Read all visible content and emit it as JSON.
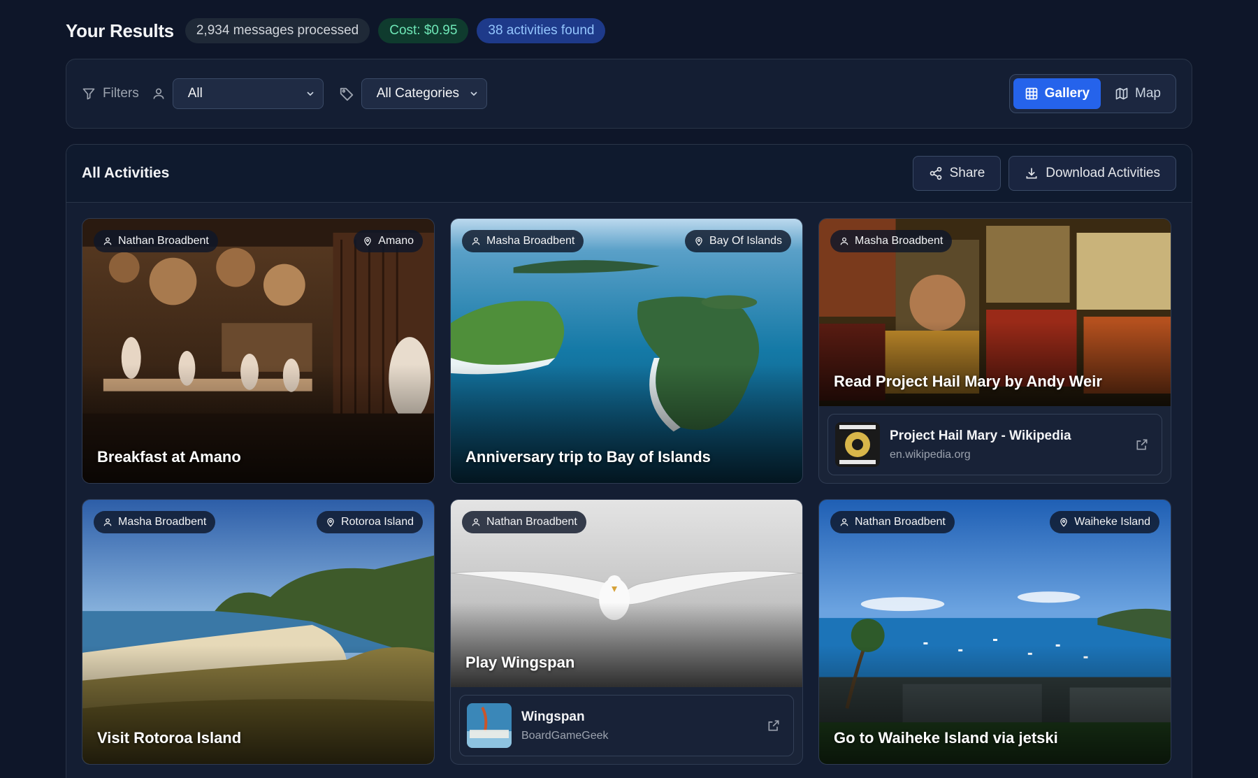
{
  "header": {
    "title": "Your Results",
    "messages_processed": "2,934 messages processed",
    "cost": "Cost: $0.95",
    "activities_found": "38 activities found"
  },
  "filters": {
    "label": "Filters",
    "person_select": {
      "value": "All"
    },
    "category_select": {
      "value": "All Categories"
    },
    "view_toggle": {
      "gallery": "Gallery",
      "map": "Map",
      "active": "gallery"
    }
  },
  "panel": {
    "title": "All Activities",
    "share_label": "Share",
    "download_label": "Download Activities"
  },
  "cards": [
    {
      "title": "Breakfast at Amano",
      "person": "Nathan Broadbent",
      "place": "Amano"
    },
    {
      "title": "Anniversary trip to Bay of Islands",
      "person": "Masha Broadbent",
      "place": "Bay Of Islands"
    },
    {
      "title": "Read Project Hail Mary by Andy Weir",
      "person": "Masha Broadbent",
      "place": "",
      "link": {
        "title": "Project Hail Mary - Wikipedia",
        "domain": "en.wikipedia.org"
      }
    },
    {
      "title": "Visit Rotoroa Island",
      "person": "Masha Broadbent",
      "place": "Rotoroa Island"
    },
    {
      "title": "Play Wingspan",
      "person": "Nathan Broadbent",
      "place": "",
      "link": {
        "title": "Wingspan",
        "domain": "BoardGameGeek"
      }
    },
    {
      "title": "Go to Waiheke Island via jetski",
      "person": "Nathan Broadbent",
      "place": "Waiheke Island"
    }
  ],
  "colors": {
    "accent": "#2563eb",
    "background": "#0e1629",
    "cost_green": "#6ee7b7",
    "activities_blue": "#93c5fd"
  }
}
